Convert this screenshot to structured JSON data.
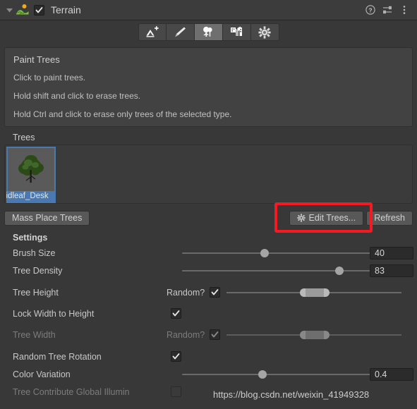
{
  "header": {
    "title": "Terrain",
    "enabled": true,
    "foldout_open": true,
    "icons": [
      "help-icon",
      "preset-icon",
      "more-menu-icon"
    ]
  },
  "toolbar": {
    "tools": [
      {
        "name": "raise-lower-terrain-tool",
        "icon": "terrain-raise-icon",
        "active": false
      },
      {
        "name": "paint-texture-tool",
        "icon": "brush-icon",
        "active": false
      },
      {
        "name": "paint-trees-tool",
        "icon": "tree-icon",
        "active": true
      },
      {
        "name": "paint-details-tool",
        "icon": "grass-detail-icon",
        "active": false
      },
      {
        "name": "terrain-settings-tool",
        "icon": "gear-icon",
        "active": false
      }
    ]
  },
  "info_box": {
    "title": "Paint Trees",
    "lines": [
      "Click to paint trees.",
      "Hold shift and click to erase trees.",
      "Hold Ctrl and click to erase only trees of the selected type."
    ]
  },
  "trees_section": {
    "label": "Trees",
    "items": [
      {
        "name": "idleaf_Desk",
        "selected": true
      }
    ]
  },
  "buttons": {
    "mass_place": "Mass Place Trees",
    "edit_trees": "Edit Trees...",
    "refresh": "Refresh",
    "highlight_color": "#f51a22"
  },
  "settings": {
    "heading": "Settings",
    "brush_size": {
      "label": "Brush Size",
      "value": "40",
      "slider_pct": 35
    },
    "tree_density": {
      "label": "Tree Density",
      "value": "83",
      "slider_pct": 78
    },
    "tree_height": {
      "label": "Tree Height",
      "random_label": "Random?",
      "random": true,
      "min_pct": 42,
      "max_pct": 54
    },
    "lock_width_to_height": {
      "label": "Lock Width to Height",
      "checked": true
    },
    "tree_width": {
      "label": "Tree Width",
      "random_label": "Random?",
      "random": true,
      "disabled": true,
      "min_pct": 42,
      "max_pct": 54
    },
    "random_tree_rotation": {
      "label": "Random Tree Rotation",
      "checked": true
    },
    "color_variation": {
      "label": "Color Variation",
      "value": "0.4",
      "slider_pct": 35
    },
    "tree_contribute_gi": {
      "label": "Tree Contribute Global Illumin",
      "checked": false,
      "disabled": true
    }
  },
  "watermark": "https://blog.csdn.net/weixin_41949328"
}
